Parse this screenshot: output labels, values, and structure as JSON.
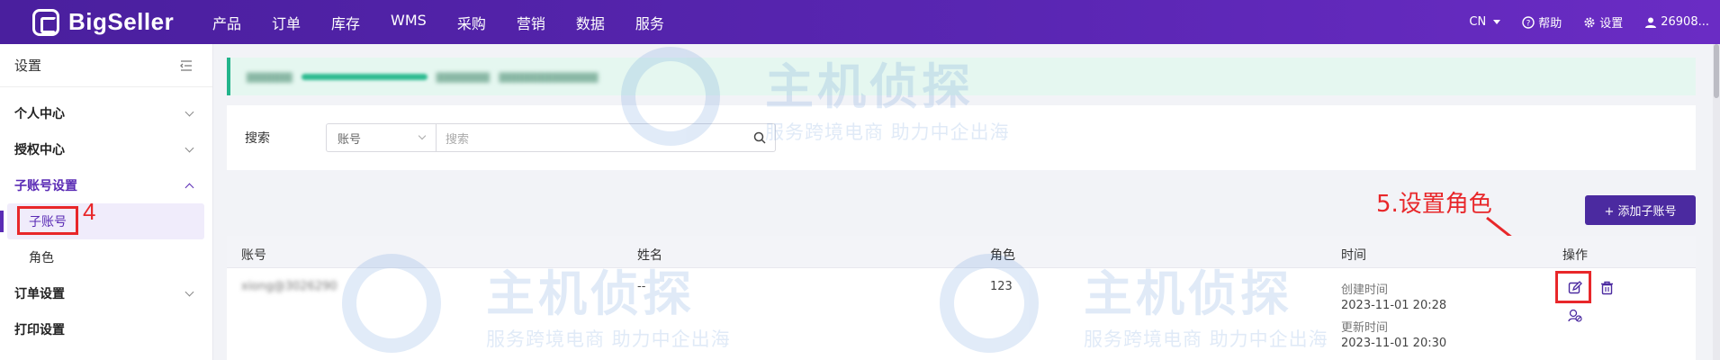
{
  "topbar": {
    "logo_text": "BigSeller",
    "nav": [
      "产品",
      "订单",
      "库存",
      "WMS",
      "采购",
      "营销",
      "数据",
      "服务"
    ],
    "lang": "CN",
    "help": "帮助",
    "settings": "设置",
    "user": "26908..."
  },
  "sidebar": {
    "title": "设置",
    "groups": {
      "personal": "个人中心",
      "auth": "授权中心",
      "subaccount": "子账号设置",
      "sub_items": [
        "子账号",
        "角色"
      ],
      "order": "订单设置",
      "print": "打印设置"
    },
    "annotation_number": "4"
  },
  "search": {
    "label": "搜索",
    "select_value": "账号",
    "placeholder": "搜索"
  },
  "actions": {
    "add_label": "+ 添加子账号",
    "annotation": "5.设置角色"
  },
  "table": {
    "columns": [
      "账号",
      "姓名",
      "角色",
      "时间",
      "操作"
    ],
    "rows": [
      {
        "account": "xiong@3026290",
        "name": "--",
        "role": "123",
        "created_label": "创建时间",
        "created": "2023-11-01 20:28",
        "updated_label": "更新时间",
        "updated": "2023-11-01 20:30"
      }
    ]
  },
  "watermark": {
    "title": "主机侦探",
    "subtitle": "服务跨境电商 助力中企出海"
  },
  "colors": {
    "topbar": "#5a26b3",
    "accent": "#5a2bb5",
    "annotation": "#e8272a",
    "banner": "#e5f7f0"
  }
}
